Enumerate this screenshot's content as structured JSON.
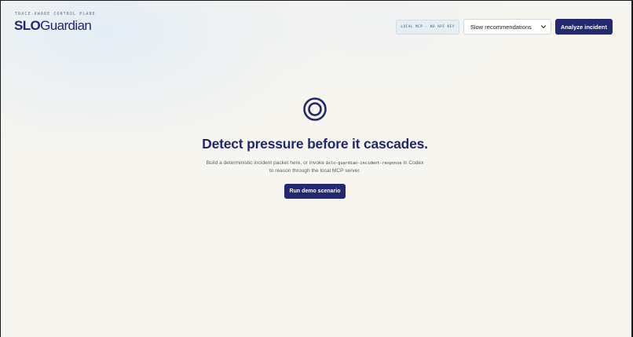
{
  "header": {
    "eyebrow": "TRACE-AWARE CONTROL PLANE",
    "brand_slo": "SLO",
    "brand_name": "Guardian",
    "status_pill": "LOCAL MCP · NO API KEY",
    "scenario_select": {
      "selected": "Slow recommendations"
    },
    "analyze_label": "Analyze incident"
  },
  "hero": {
    "icon": "target-rings-icon",
    "headline": "Detect pressure before it cascades.",
    "desc_before": "Build a deterministic incident packet here, or invoke ",
    "desc_code": "$slo-guardian-incident-response",
    "desc_after": " in Codex",
    "desc_line2": "to reason through the local MCP server.",
    "demo_label": "Run demo scenario"
  },
  "colors": {
    "brand": "#24286e",
    "background": "#f6f5f0",
    "pill_bg": "#e6eef3"
  }
}
